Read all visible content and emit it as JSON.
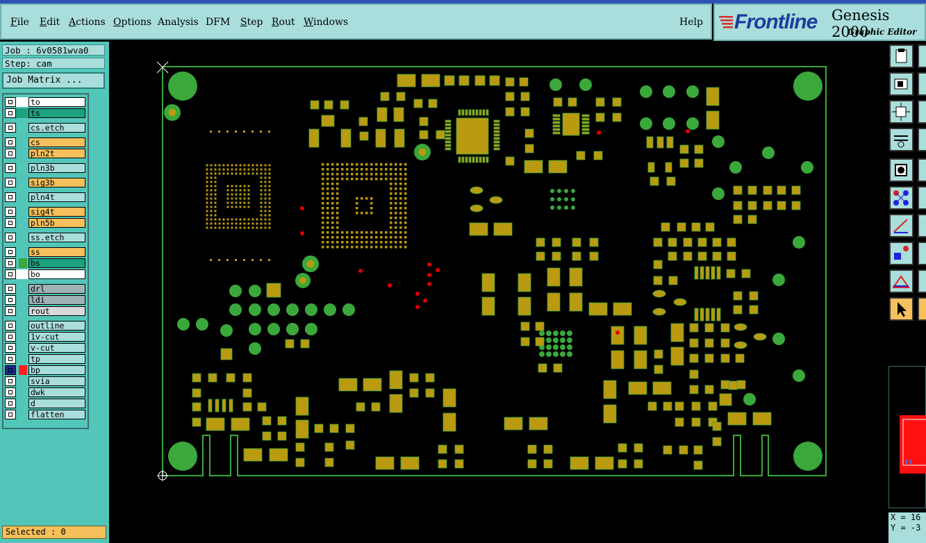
{
  "app": {
    "logo_word": "Frontline",
    "title": "Genesis 2000",
    "subtitle": "Graphic Editor"
  },
  "menu": [
    {
      "label": "File",
      "ul": "F",
      "rest": "ile"
    },
    {
      "label": "Edit",
      "ul": "E",
      "rest": "dit"
    },
    {
      "label": "Actions",
      "ul": "A",
      "rest": "ctions"
    },
    {
      "label": "Options",
      "ul": "O",
      "rest": "ptions"
    },
    {
      "label": "Analysis",
      "ul": "",
      "rest": "Analysis"
    },
    {
      "label": "DFM",
      "ul": "",
      "rest": "DFM"
    },
    {
      "label": "Step",
      "ul": "S",
      "rest": "tep"
    },
    {
      "label": "Rout",
      "ul": "R",
      "rest": "out"
    },
    {
      "label": "Windows",
      "ul": "W",
      "rest": "indows"
    }
  ],
  "help_label": "Help",
  "job_line": "Job : 6v0581wva0",
  "step_line": "Step: cam",
  "job_matrix_label": "Job Matrix ...",
  "selected_line": "Selected : 0",
  "coords": {
    "x": "X = 16",
    "y": "Y = -3"
  },
  "colors": {
    "board_outline": "#3aa83a",
    "pad": "#b99a10",
    "pad_edge": "#3aa83a",
    "via": "#3aa83a",
    "red_dot": "#e00000",
    "panel": "#52c7b9",
    "menu_bg": "#a9dedc",
    "selected_bg": "#f6c05c"
  },
  "layers": [
    {
      "name": "to",
      "color": "#ffffff",
      "sw": "#ffffff"
    },
    {
      "name": "ts",
      "color": "#1ca27e",
      "sw": "#1ca27e"
    },
    {
      "name": "cs.etch",
      "color": "#a9dedc",
      "sw": "#52c7b9"
    },
    {
      "name": "cs",
      "color": "#f6c05c",
      "sw": "#52c7b9"
    },
    {
      "name": "pln2t",
      "color": "#f6c05c",
      "sw": "#52c7b9"
    },
    {
      "name": "pln3b",
      "color": "#a9dedc",
      "sw": "#52c7b9"
    },
    {
      "name": "sig3b",
      "color": "#f6c05c",
      "sw": "#52c7b9"
    },
    {
      "name": "pln4t",
      "color": "#a9dedc",
      "sw": "#52c7b9"
    },
    {
      "name": "sig4t",
      "color": "#f6c05c",
      "sw": "#52c7b9"
    },
    {
      "name": "pln5b",
      "color": "#f6c05c",
      "sw": "#52c7b9"
    },
    {
      "name": "ss.etch",
      "color": "#a9dedc",
      "sw": "#52c7b9"
    },
    {
      "name": "ss",
      "color": "#f6c05c",
      "sw": "#52c7b9"
    },
    {
      "name": "bs",
      "color": "#1ca27e",
      "sw": "#3aa83a"
    },
    {
      "name": "bo",
      "color": "#ffffff",
      "sw": "#ffffff"
    },
    {
      "name": "drl",
      "color": "#9fb2b6",
      "sw": "#52c7b9"
    },
    {
      "name": "ldi",
      "color": "#9fb2b6",
      "sw": "#52c7b9"
    },
    {
      "name": "rout",
      "color": "#d6dada",
      "sw": "#52c7b9"
    },
    {
      "name": "outline",
      "color": "#a9dedc",
      "sw": "#52c7b9"
    },
    {
      "name": "1v-cut",
      "color": "#a9dedc",
      "sw": "#52c7b9"
    },
    {
      "name": "v-cut",
      "color": "#a9dedc",
      "sw": "#52c7b9"
    },
    {
      "name": "tp",
      "color": "#a9dedc",
      "sw": "#52c7b9"
    },
    {
      "name": "bp",
      "color": "#a9dedc",
      "sw": "#ff2020"
    },
    {
      "name": "svia",
      "color": "#a9dedc",
      "sw": "#52c7b9"
    },
    {
      "name": "dwk",
      "color": "#a9dedc",
      "sw": "#52c7b9"
    },
    {
      "name": "d",
      "color": "#a9dedc",
      "sw": "#52c7b9"
    },
    {
      "name": "flatten",
      "color": "#a9dedc",
      "sw": "#52c7b9"
    }
  ]
}
